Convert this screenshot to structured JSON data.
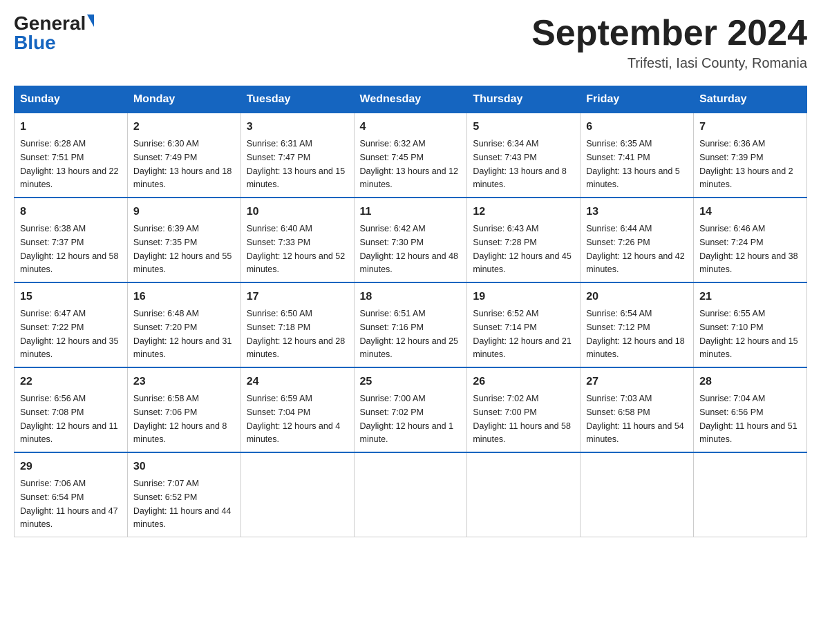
{
  "header": {
    "logo_general": "General",
    "logo_blue": "Blue",
    "title": "September 2024",
    "subtitle": "Trifesti, Iasi County, Romania"
  },
  "days_of_week": [
    "Sunday",
    "Monday",
    "Tuesday",
    "Wednesday",
    "Thursday",
    "Friday",
    "Saturday"
  ],
  "weeks": [
    [
      {
        "day": "1",
        "sunrise": "6:28 AM",
        "sunset": "7:51 PM",
        "daylight": "13 hours and 22 minutes."
      },
      {
        "day": "2",
        "sunrise": "6:30 AM",
        "sunset": "7:49 PM",
        "daylight": "13 hours and 18 minutes."
      },
      {
        "day": "3",
        "sunrise": "6:31 AM",
        "sunset": "7:47 PM",
        "daylight": "13 hours and 15 minutes."
      },
      {
        "day": "4",
        "sunrise": "6:32 AM",
        "sunset": "7:45 PM",
        "daylight": "13 hours and 12 minutes."
      },
      {
        "day": "5",
        "sunrise": "6:34 AM",
        "sunset": "7:43 PM",
        "daylight": "13 hours and 8 minutes."
      },
      {
        "day": "6",
        "sunrise": "6:35 AM",
        "sunset": "7:41 PM",
        "daylight": "13 hours and 5 minutes."
      },
      {
        "day": "7",
        "sunrise": "6:36 AM",
        "sunset": "7:39 PM",
        "daylight": "13 hours and 2 minutes."
      }
    ],
    [
      {
        "day": "8",
        "sunrise": "6:38 AM",
        "sunset": "7:37 PM",
        "daylight": "12 hours and 58 minutes."
      },
      {
        "day": "9",
        "sunrise": "6:39 AM",
        "sunset": "7:35 PM",
        "daylight": "12 hours and 55 minutes."
      },
      {
        "day": "10",
        "sunrise": "6:40 AM",
        "sunset": "7:33 PM",
        "daylight": "12 hours and 52 minutes."
      },
      {
        "day": "11",
        "sunrise": "6:42 AM",
        "sunset": "7:30 PM",
        "daylight": "12 hours and 48 minutes."
      },
      {
        "day": "12",
        "sunrise": "6:43 AM",
        "sunset": "7:28 PM",
        "daylight": "12 hours and 45 minutes."
      },
      {
        "day": "13",
        "sunrise": "6:44 AM",
        "sunset": "7:26 PM",
        "daylight": "12 hours and 42 minutes."
      },
      {
        "day": "14",
        "sunrise": "6:46 AM",
        "sunset": "7:24 PM",
        "daylight": "12 hours and 38 minutes."
      }
    ],
    [
      {
        "day": "15",
        "sunrise": "6:47 AM",
        "sunset": "7:22 PM",
        "daylight": "12 hours and 35 minutes."
      },
      {
        "day": "16",
        "sunrise": "6:48 AM",
        "sunset": "7:20 PM",
        "daylight": "12 hours and 31 minutes."
      },
      {
        "day": "17",
        "sunrise": "6:50 AM",
        "sunset": "7:18 PM",
        "daylight": "12 hours and 28 minutes."
      },
      {
        "day": "18",
        "sunrise": "6:51 AM",
        "sunset": "7:16 PM",
        "daylight": "12 hours and 25 minutes."
      },
      {
        "day": "19",
        "sunrise": "6:52 AM",
        "sunset": "7:14 PM",
        "daylight": "12 hours and 21 minutes."
      },
      {
        "day": "20",
        "sunrise": "6:54 AM",
        "sunset": "7:12 PM",
        "daylight": "12 hours and 18 minutes."
      },
      {
        "day": "21",
        "sunrise": "6:55 AM",
        "sunset": "7:10 PM",
        "daylight": "12 hours and 15 minutes."
      }
    ],
    [
      {
        "day": "22",
        "sunrise": "6:56 AM",
        "sunset": "7:08 PM",
        "daylight": "12 hours and 11 minutes."
      },
      {
        "day": "23",
        "sunrise": "6:58 AM",
        "sunset": "7:06 PM",
        "daylight": "12 hours and 8 minutes."
      },
      {
        "day": "24",
        "sunrise": "6:59 AM",
        "sunset": "7:04 PM",
        "daylight": "12 hours and 4 minutes."
      },
      {
        "day": "25",
        "sunrise": "7:00 AM",
        "sunset": "7:02 PM",
        "daylight": "12 hours and 1 minute."
      },
      {
        "day": "26",
        "sunrise": "7:02 AM",
        "sunset": "7:00 PM",
        "daylight": "11 hours and 58 minutes."
      },
      {
        "day": "27",
        "sunrise": "7:03 AM",
        "sunset": "6:58 PM",
        "daylight": "11 hours and 54 minutes."
      },
      {
        "day": "28",
        "sunrise": "7:04 AM",
        "sunset": "6:56 PM",
        "daylight": "11 hours and 51 minutes."
      }
    ],
    [
      {
        "day": "29",
        "sunrise": "7:06 AM",
        "sunset": "6:54 PM",
        "daylight": "11 hours and 47 minutes."
      },
      {
        "day": "30",
        "sunrise": "7:07 AM",
        "sunset": "6:52 PM",
        "daylight": "11 hours and 44 minutes."
      },
      null,
      null,
      null,
      null,
      null
    ]
  ]
}
